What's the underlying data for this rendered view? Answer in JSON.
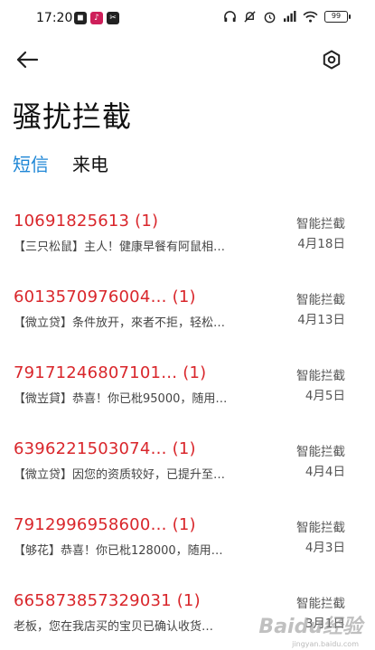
{
  "status_bar": {
    "time": "17:20",
    "battery": "99"
  },
  "header": {
    "title": "骚扰拦截"
  },
  "tabs": [
    {
      "label": "短信",
      "active": true
    },
    {
      "label": "来电",
      "active": false
    }
  ],
  "messages": [
    {
      "number": "10691825613 (1)",
      "preview": "【三只松鼠】主人！健康早餐有阿鼠相…",
      "tag": "智能拦截",
      "date": "4月18日"
    },
    {
      "number": "6013570976004… (1)",
      "preview": "【微立贷】条件放开，來者不拒，轻松…",
      "tag": "智能拦截",
      "date": "4月13日"
    },
    {
      "number": "79171246807101… (1)",
      "preview": "【微岦貸】恭喜！你已枇95000，随用…",
      "tag": "智能拦截",
      "date": "4月5日"
    },
    {
      "number": "6396221503074… (1)",
      "preview": "【微立贷】因您的资质较好，已提升至…",
      "tag": "智能拦截",
      "date": "4月4日"
    },
    {
      "number": "7912996958600… (1)",
      "preview": "【够花】恭喜！你已枇128000，随用…",
      "tag": "智能拦截",
      "date": "4月3日"
    },
    {
      "number": "665873857329031 (1)",
      "preview": "老板，您在我店买的宝贝已确认收货…",
      "tag": "智能拦截",
      "date": "3月1日"
    }
  ],
  "watermark": {
    "text": "Baidu经验",
    "sub": "jingyan.baidu.com"
  },
  "colors": {
    "accent": "#1d86d6",
    "number_red": "#d9262b"
  }
}
